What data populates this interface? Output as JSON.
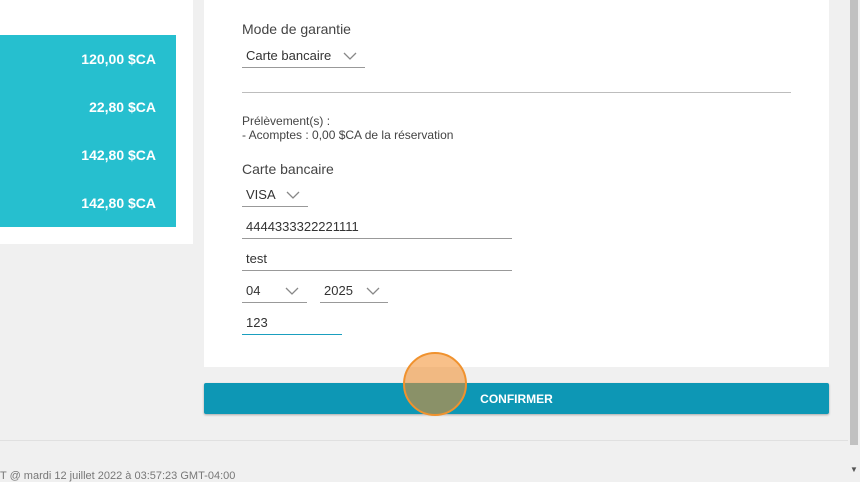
{
  "totals": {
    "rows": [
      "120,00 $CA",
      "22,80 $CA",
      "142,80 $CA",
      "142,80 $CA"
    ]
  },
  "guarantee": {
    "label": "Mode de garantie",
    "value": "Carte bancaire"
  },
  "deductions": {
    "title": "Prélèvement(s) :",
    "line": "- Acomptes : 0,00 $CA de la réservation"
  },
  "card": {
    "label": "Carte bancaire",
    "type": "VISA",
    "number": "4444333322221111",
    "holder": "test",
    "month": "04",
    "year": "2025",
    "cvv": "123"
  },
  "confirm_label": "CONFIRMER",
  "footer_text": "T @ mardi 12 juillet 2022 à 03:57:23 GMT-04:00",
  "colors": {
    "accent": "#26bfcf",
    "button": "#0d97b5",
    "cursor": "#f0922e"
  }
}
